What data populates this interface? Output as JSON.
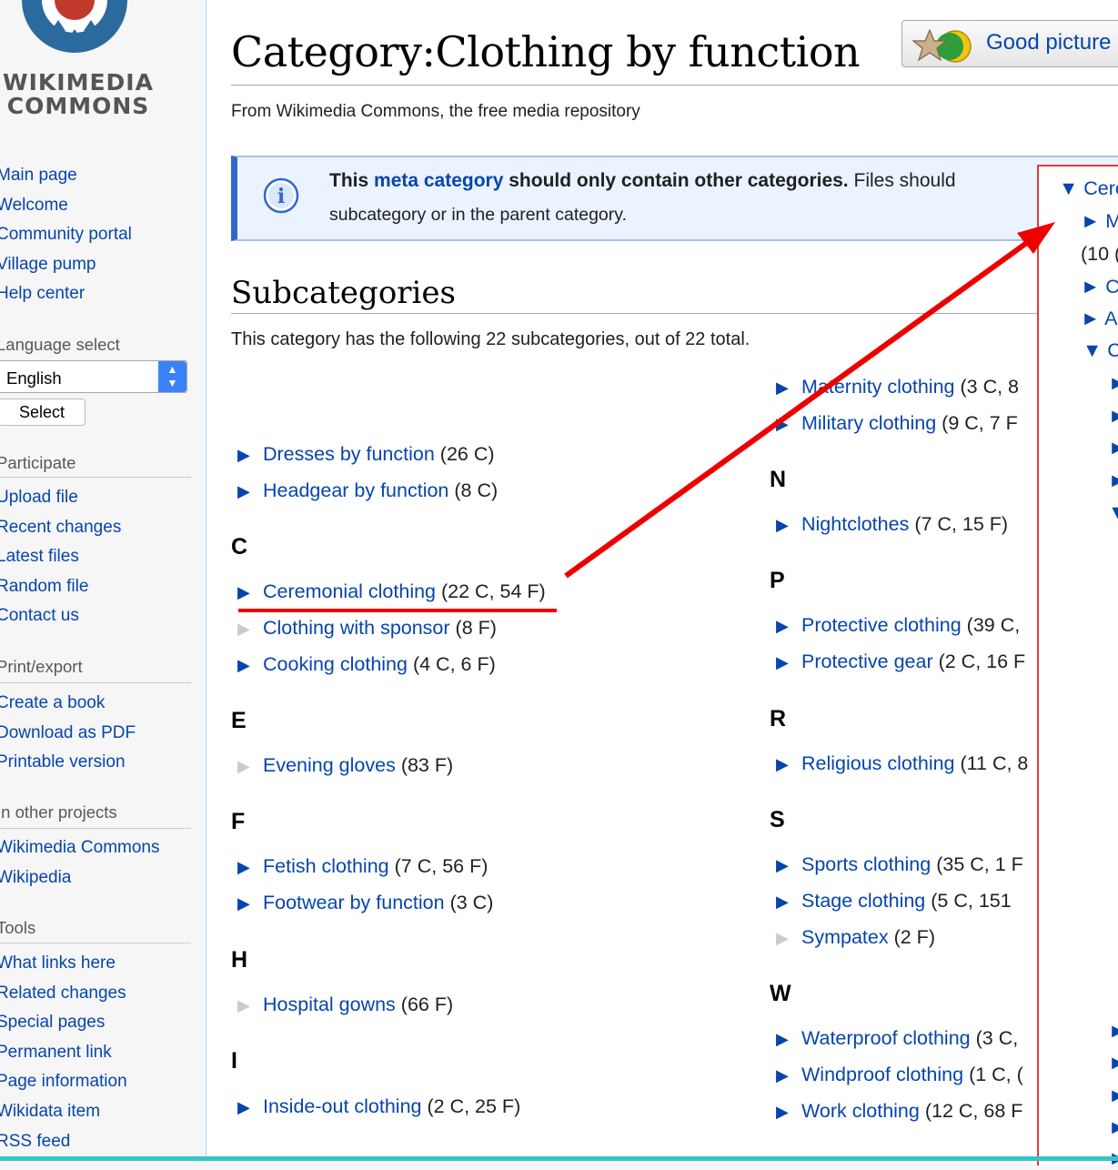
{
  "sidebar": {
    "logo_line1": "WIKIMEDIA",
    "logo_line2": "COMMONS",
    "main_nav": [
      "Main page",
      "Welcome",
      "Community portal",
      "Village pump",
      "Help center"
    ],
    "language_select": {
      "heading": "Language select",
      "value": "English",
      "button": "Select"
    },
    "participate": {
      "heading": "Participate",
      "items": [
        "Upload file",
        "Recent changes",
        "Latest files",
        "Random file",
        "Contact us"
      ]
    },
    "print_export": {
      "heading": "Print/export",
      "items": [
        "Create a book",
        "Download as PDF",
        "Printable version"
      ]
    },
    "other_projects": {
      "heading": "In other projects",
      "items": [
        "Wikimedia Commons",
        "Wikipedia"
      ]
    },
    "tools": {
      "heading": "Tools",
      "items": [
        "What links here",
        "Related changes",
        "Special pages",
        "Permanent link",
        "Page information",
        "Wikidata item",
        "RSS feed"
      ]
    }
  },
  "content": {
    "title": "Category:Clothing by function",
    "good_picture": "Good picture",
    "site_sub": "From Wikimedia Commons, the free media repository",
    "meta_box": {
      "part1": "This ",
      "link": "meta category",
      "part2": " should only contain other categories.",
      "part3": " Files should",
      "line2": "subcategory or in the parent category."
    },
    "subcategories_heading": "Subcategories",
    "subcategories_count": "This category has the following 22 subcategories, out of 22 total.",
    "left_column": [
      {
        "type": "cat",
        "name": "Dresses by function",
        "count": "(26 C)",
        "expandable": true
      },
      {
        "type": "cat",
        "name": "Headgear by function",
        "count": "(8 C)",
        "expandable": true
      },
      {
        "type": "letter",
        "text": "C"
      },
      {
        "type": "cat",
        "name": "Ceremonial clothing",
        "count": "(22 C, 54 F)",
        "expandable": true
      },
      {
        "type": "cat",
        "name": "Clothing with sponsor",
        "count": "(8 F)",
        "expandable": false
      },
      {
        "type": "cat",
        "name": "Cooking clothing",
        "count": "(4 C, 6 F)",
        "expandable": true
      },
      {
        "type": "letter",
        "text": "E"
      },
      {
        "type": "cat",
        "name": "Evening gloves",
        "count": "(83 F)",
        "expandable": false
      },
      {
        "type": "letter",
        "text": "F"
      },
      {
        "type": "cat",
        "name": "Fetish clothing",
        "count": "(7 C, 56 F)",
        "expandable": true
      },
      {
        "type": "cat",
        "name": "Footwear by function",
        "count": "(3 C)",
        "expandable": true
      },
      {
        "type": "letter",
        "text": "H"
      },
      {
        "type": "cat",
        "name": "Hospital gowns",
        "count": "(66 F)",
        "expandable": false
      },
      {
        "type": "letter",
        "text": "I"
      },
      {
        "type": "cat",
        "name": "Inside-out clothing",
        "count": "(2 C, 25 F)",
        "expandable": true
      }
    ],
    "right_column": [
      {
        "type": "cat",
        "name": "Maternity clothing",
        "count": "(3 C, 8",
        "expandable": true
      },
      {
        "type": "cat",
        "name": "Military clothing",
        "count": "(9 C, 7 F",
        "expandable": true
      },
      {
        "type": "letter",
        "text": "N"
      },
      {
        "type": "cat",
        "name": "Nightclothes",
        "count": "(7 C, 15 F)",
        "expandable": true
      },
      {
        "type": "letter",
        "text": "P"
      },
      {
        "type": "cat",
        "name": "Protective clothing",
        "count": "(39 C,",
        "expandable": true
      },
      {
        "type": "cat",
        "name": "Protective gear",
        "count": "(2 C, 16 F",
        "expandable": true
      },
      {
        "type": "letter",
        "text": "R"
      },
      {
        "type": "cat",
        "name": "Religious clothing",
        "count": "(11 C, 8",
        "expandable": true
      },
      {
        "type": "letter",
        "text": "S"
      },
      {
        "type": "cat",
        "name": "Sports clothing",
        "count": "(35 C, 1 F",
        "expandable": true
      },
      {
        "type": "cat",
        "name": "Stage clothing",
        "count": "(5 C, 151",
        "expandable": true
      },
      {
        "type": "cat",
        "name": "Sympatex",
        "count": "(2 F)",
        "expandable": false
      },
      {
        "type": "letter",
        "text": "W"
      },
      {
        "type": "cat",
        "name": "Waterproof clothing",
        "count": "(3 C,",
        "expandable": true
      },
      {
        "type": "cat",
        "name": "Windproof clothing",
        "count": "(1 C, (",
        "expandable": true
      },
      {
        "type": "cat",
        "name": "Work clothing",
        "count": "(12 C, 68 F",
        "expandable": true
      }
    ]
  },
  "tree_panel": {
    "items": [
      "▼ Cere",
      "► M",
      "(10 (",
      "► C",
      "► A",
      "▼ C",
      "►",
      "►",
      "►",
      "►",
      "▼",
      "►",
      "►",
      "►",
      "►",
      "►"
    ]
  },
  "colors": {
    "link": "#0645ad",
    "annotation": "#ee0000",
    "frame": "#36c5c5",
    "notice_border": "#3366cc"
  }
}
